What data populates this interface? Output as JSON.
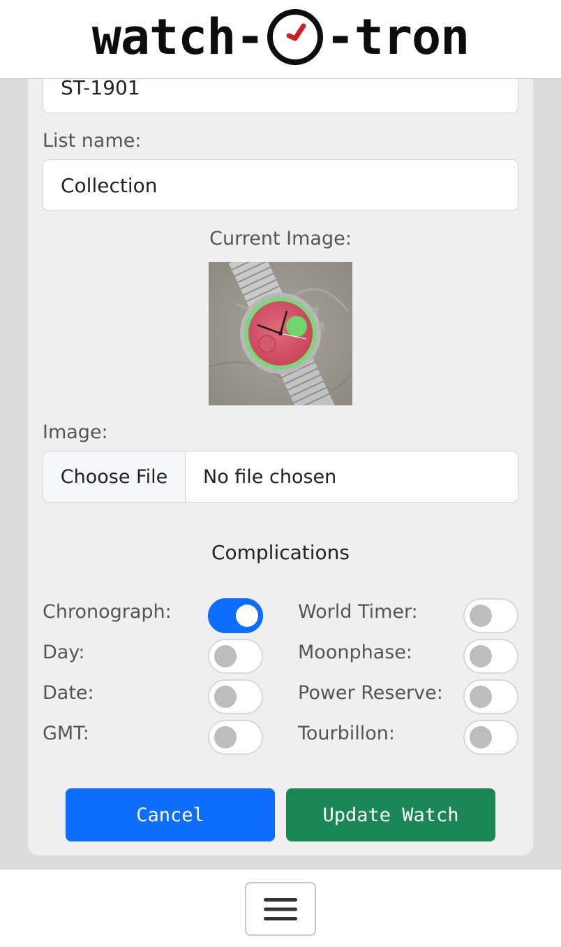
{
  "header": {
    "logo_left": "watch-",
    "logo_right": "-tron"
  },
  "form": {
    "model_value": "ST-1901",
    "list_name_label": "List name:",
    "list_name_value": "Collection",
    "current_image_label": "Current Image:",
    "image_label": "Image:",
    "choose_file_label": "Choose File",
    "file_status": "No file chosen"
  },
  "complications": {
    "title": "Complications",
    "items": [
      {
        "label": "Chronograph:",
        "checked": true
      },
      {
        "label": "Day:",
        "checked": false
      },
      {
        "label": "Date:",
        "checked": false
      },
      {
        "label": "GMT:",
        "checked": false
      },
      {
        "label": "World Timer:",
        "checked": false
      },
      {
        "label": "Moonphase:",
        "checked": false
      },
      {
        "label": "Power Reserve:",
        "checked": false
      },
      {
        "label": "Tourbillon:",
        "checked": false
      }
    ]
  },
  "actions": {
    "cancel_label": "Cancel",
    "update_label": "Update Watch"
  },
  "colors": {
    "primary": "#0d6efd",
    "success": "#198754",
    "logo_hand": "#cc1f1f"
  },
  "footer": {
    "menu_icon": "hamburger-menu-icon"
  }
}
